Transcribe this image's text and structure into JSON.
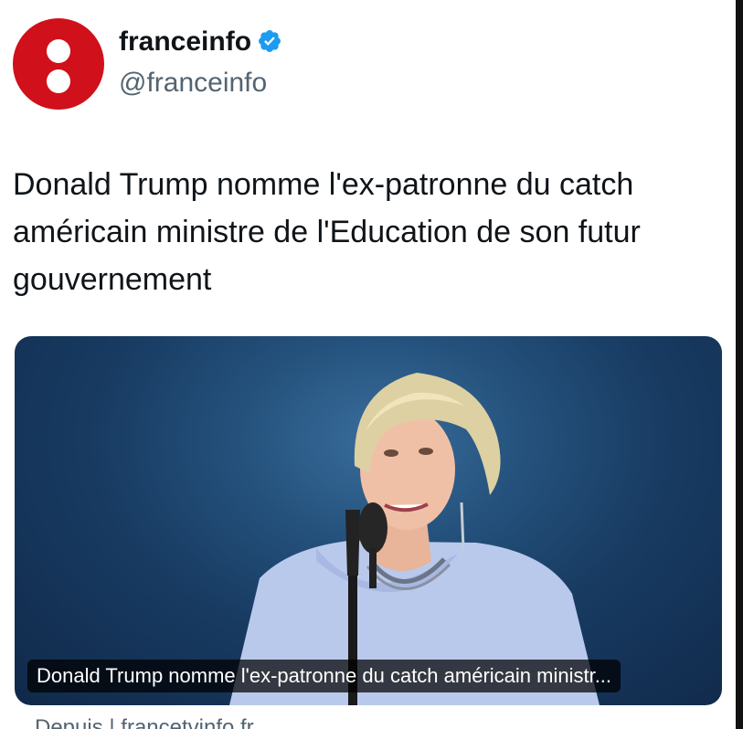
{
  "account": {
    "display_name": "franceinfo",
    "handle": "@franceinfo",
    "verified_icon": "verified-badge-icon",
    "avatar_color": "#d0101a"
  },
  "tweet": {
    "text": "Donald Trump nomme l'ex-patronne du catch américain ministre de l'Education de son futur gouvernement"
  },
  "media": {
    "caption": "Donald Trump nomme l'ex-patronne du catch américain ministr...",
    "source": "Depuis | francetvinfo.fr"
  },
  "colors": {
    "text": "#0f1419",
    "secondary": "#536471",
    "verified": "#1d9bf0"
  }
}
